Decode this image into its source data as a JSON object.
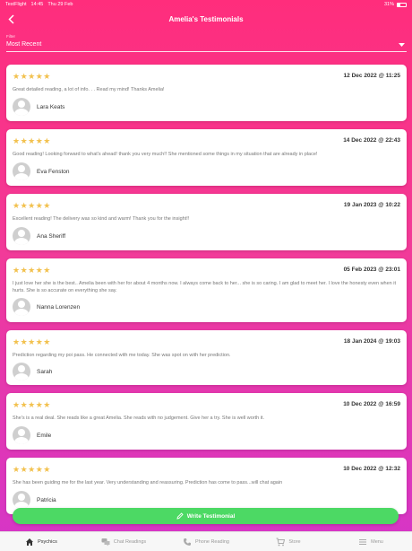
{
  "status_bar": {
    "carrier": "TestFlight",
    "time": "14:45",
    "date": "Thu 29 Feb",
    "battery": "31%"
  },
  "header": {
    "title": "Amelia's Testimonials"
  },
  "filter": {
    "label": "Filter",
    "value": "Most Recent"
  },
  "testimonials": [
    {
      "stars": "★★★★★",
      "date": "12 Dec 2022 @ 11:25",
      "text": "Great detailed reading, a lot of info. . . Read my mind! Thanks Amelia!",
      "name": "Lara Keats"
    },
    {
      "stars": "★★★★★",
      "date": "14 Dec 2022 @ 22:43",
      "text": "Good reading! Looking forward to what's ahead! thank you very much!! She mentioned some things in my situation that are already in place!",
      "name": "Eva Fenston"
    },
    {
      "stars": "★★★★★",
      "date": "19 Jan 2023 @ 10:22",
      "text": "Excellent reading! The delivery was so kind and warm! Thank you for the insight!!",
      "name": "Ana Sheriff"
    },
    {
      "stars": "★★★★★",
      "date": "05 Feb 2023 @ 23:01",
      "text": "I just love her she is the best.. Amelia been with her for about 4 months now. I always come back to her... she is so caring. I am glad to meet her. I love the honesty even when it hurts. She is so accurate on everything she say.",
      "name": "Nanna Lorenzen"
    },
    {
      "stars": "★★★★★",
      "date": "18 Jan 2024 @ 19:03",
      "text": "Prediction regarding my poi pass. He connected with me today. She was spot on with her prediction.",
      "name": "Sarah"
    },
    {
      "stars": "★★★★★",
      "date": "10 Dec 2022 @ 16:59",
      "text": "She's is a real deal. She reads like a great Amelia. She reads with no judgement. Give her a try. She is well worth it.",
      "name": "Emile"
    },
    {
      "stars": "★★★★★",
      "date": "10 Dec 2022 @ 12:32",
      "text": "She has been guiding me for the last year. Very understanding and reassuring. Prediction has come to pass...will chat again",
      "name": "Patricia"
    }
  ],
  "write_button": {
    "label": "Write Testimonial"
  },
  "tabs": [
    {
      "label": "Psychics",
      "icon": "home-icon"
    },
    {
      "label": "Chat Readings",
      "icon": "chat-icon"
    },
    {
      "label": "Phone Reading",
      "icon": "phone-icon"
    },
    {
      "label": "Store",
      "icon": "cart-icon"
    },
    {
      "label": "Menu",
      "icon": "menu-icon"
    }
  ],
  "colors": {
    "accent": "#ff2d7c",
    "gradient_end": "#d535c8",
    "star": "#f2c14e",
    "write_button": "#4cd964"
  }
}
